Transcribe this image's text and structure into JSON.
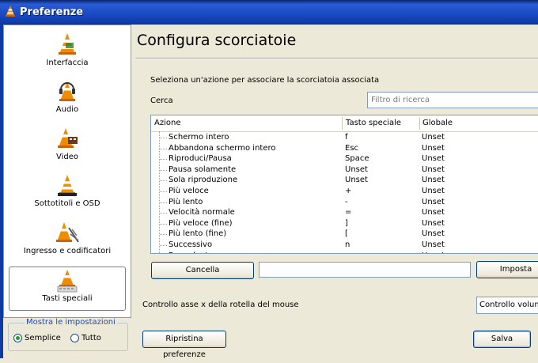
{
  "window": {
    "title": "Preferenze"
  },
  "sidebar": {
    "items": [
      {
        "label": "Interfaccia",
        "icon": "cone-icon"
      },
      {
        "label": "Audio",
        "icon": "cone-headphones-icon"
      },
      {
        "label": "Video",
        "icon": "cone-film-icon"
      },
      {
        "label": "Sottotitoli e OSD",
        "icon": "cone-subtitles-icon"
      },
      {
        "label": "Ingresso e codificatori",
        "icon": "cone-input-icon"
      },
      {
        "label": "Tasti speciali",
        "icon": "cone-keyboard-icon",
        "selected": true
      }
    ],
    "show_settings": {
      "legend": "Mostra le impostazioni",
      "options": [
        {
          "label": "Semplice",
          "checked": true
        },
        {
          "label": "Tutto",
          "checked": false
        }
      ]
    }
  },
  "main": {
    "title": "Configura scorciatoie",
    "instruction": "Seleziona un'azione per associare la scorciatoia associata",
    "search": {
      "label": "Cerca",
      "placeholder": "Filtro di ricerca"
    },
    "table": {
      "headers": [
        "Azione",
        "Tasto speciale",
        "Globale"
      ],
      "rows": [
        [
          "Schermo intero",
          "f",
          "Unset"
        ],
        [
          "Abbandona schermo intero",
          "Esc",
          "Unset"
        ],
        [
          "Riproduci/Pausa",
          "Space",
          "Unset"
        ],
        [
          "Pausa solamente",
          "Unset",
          "Unset"
        ],
        [
          "Sola riproduzione",
          "Unset",
          "Unset"
        ],
        [
          "Più veloce",
          "+",
          "Unset"
        ],
        [
          "Più lento",
          "-",
          "Unset"
        ],
        [
          "Velocità normale",
          "=",
          "Unset"
        ],
        [
          "Più veloce (fine)",
          "]",
          "Unset"
        ],
        [
          "Più lento (fine)",
          "[",
          "Unset"
        ],
        [
          "Successivo",
          "n",
          "Unset"
        ],
        [
          "Precedente",
          "p",
          "Unset"
        ]
      ]
    },
    "buttons": {
      "clear": "Cancella",
      "set": "Imposta"
    },
    "mouse_wheel": {
      "label": "Controllo asse x della rotella del mouse",
      "value": "Controllo volume"
    },
    "footer": {
      "reset": "Ripristina preferenze",
      "save": "Salva"
    }
  },
  "colors": {
    "titlebar": "#1c4cc4",
    "accent": "#f08c00",
    "border": "#7f9db9"
  }
}
